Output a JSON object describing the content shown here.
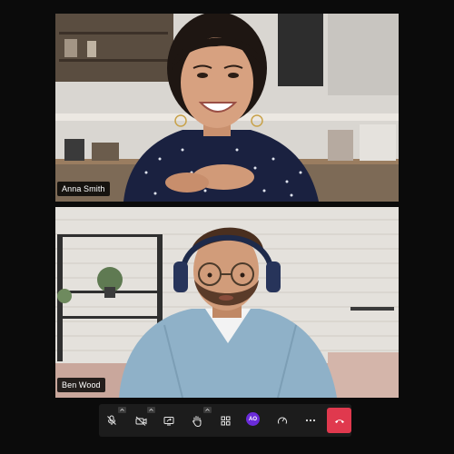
{
  "participants": [
    {
      "name": "Anna Smith"
    },
    {
      "name": "Ben Wood"
    }
  ],
  "controls": {
    "mic": {
      "icon": "mic-off-icon",
      "muted": true
    },
    "camera": {
      "icon": "camera-off-icon",
      "off": true
    },
    "share_screen": {
      "icon": "share-screen-icon"
    },
    "raise_hand": {
      "icon": "raise-hand-icon"
    },
    "layout": {
      "icon": "grid-layout-icon"
    },
    "avatar": {
      "initials": "AO",
      "color": "#6a2bd9"
    },
    "stats": {
      "icon": "speedometer-icon"
    },
    "more": {
      "icon": "more-horizontal-icon"
    },
    "end_call": {
      "icon": "hang-up-icon",
      "color": "#e0394e"
    }
  },
  "colors": {
    "background": "#0b0b0b",
    "control_bar": "#1c1c1c",
    "accent": "#6a2bd9",
    "danger": "#e0394e"
  }
}
